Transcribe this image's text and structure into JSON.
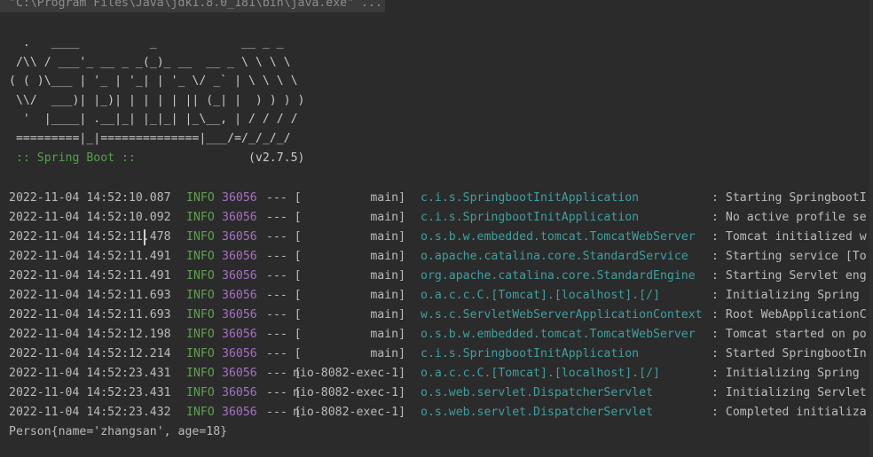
{
  "command": "\"C:\\Program Files\\Java\\jdk1.8.0_181\\bin\\java.exe\" ...",
  "banner": {
    "lines": [
      "  .   ____          _            __ _ _",
      " /\\\\ / ___'_ __ _ _(_)_ __  __ _ \\ \\ \\ \\",
      "( ( )\\___ | '_ | '_| | '_ \\/ _` | \\ \\ \\ \\",
      " \\\\/  ___)| |_)| | | | | || (_| |  ) ) ) )",
      "  '  |____| .__|_| |_|_| |_\\__, | / / / /",
      " =========|_|==============|___/=/_/_/_/"
    ],
    "spring_label": " :: Spring Boot :: ",
    "version": "               (v2.7.5)"
  },
  "logs": [
    {
      "ts": "2022-11-04 14:52:10.087",
      "level": "INFO",
      "pid": "36056",
      "sep": "--- [",
      "thread": "           main]",
      "logger": "c.i.s.SpringbootInitApplication",
      "msg": ": Starting SpringbootI"
    },
    {
      "ts": "2022-11-04 14:52:10.092",
      "level": "INFO",
      "pid": "36056",
      "sep": "--- [",
      "thread": "           main]",
      "logger": "c.i.s.SpringbootInitApplication",
      "msg": ": No active profile se"
    },
    {
      "ts": "2022-11-04 14:52:11.478",
      "level": "INFO",
      "pid": "36056",
      "sep": "--- [",
      "thread": "           main]",
      "logger": "o.s.b.w.embedded.tomcat.TomcatWebServer",
      "msg": ": Tomcat initialized w"
    },
    {
      "ts": "2022-11-04 14:52:11.491",
      "level": "INFO",
      "pid": "36056",
      "sep": "--- [",
      "thread": "           main]",
      "logger": "o.apache.catalina.core.StandardService",
      "msg": ": Starting service [To"
    },
    {
      "ts": "2022-11-04 14:52:11.491",
      "level": "INFO",
      "pid": "36056",
      "sep": "--- [",
      "thread": "           main]",
      "logger": "org.apache.catalina.core.StandardEngine",
      "msg": ": Starting Servlet eng"
    },
    {
      "ts": "2022-11-04 14:52:11.693",
      "level": "INFO",
      "pid": "36056",
      "sep": "--- [",
      "thread": "           main]",
      "logger": "o.a.c.c.C.[Tomcat].[localhost].[/]",
      "msg": ": Initializing Spring "
    },
    {
      "ts": "2022-11-04 14:52:11.693",
      "level": "INFO",
      "pid": "36056",
      "sep": "--- [",
      "thread": "           main]",
      "logger": "w.s.c.ServletWebServerApplicationContext",
      "msg": ": Root WebApplicationC"
    },
    {
      "ts": "2022-11-04 14:52:12.198",
      "level": "INFO",
      "pid": "36056",
      "sep": "--- [",
      "thread": "           main]",
      "logger": "o.s.b.w.embedded.tomcat.TomcatWebServer",
      "msg": ": Tomcat started on po"
    },
    {
      "ts": "2022-11-04 14:52:12.214",
      "level": "INFO",
      "pid": "36056",
      "sep": "--- [",
      "thread": "           main]",
      "logger": "c.i.s.SpringbootInitApplication",
      "msg": ": Started SpringbootIn"
    },
    {
      "ts": "2022-11-04 14:52:23.431",
      "level": "INFO",
      "pid": "36056",
      "sep": "--- [",
      "thread": "nio-8082-exec-1]",
      "logger": "o.a.c.c.C.[Tomcat].[localhost].[/]",
      "msg": ": Initializing Spring "
    },
    {
      "ts": "2022-11-04 14:52:23.431",
      "level": "INFO",
      "pid": "36056",
      "sep": "--- [",
      "thread": "nio-8082-exec-1]",
      "logger": "o.s.web.servlet.DispatcherServlet",
      "msg": ": Initializing Servlet"
    },
    {
      "ts": "2022-11-04 14:52:23.432",
      "level": "INFO",
      "pid": "36056",
      "sep": "--- [",
      "thread": "nio-8082-exec-1]",
      "logger": "o.s.web.servlet.DispatcherServlet",
      "msg": ": Completed initializa"
    }
  ],
  "output": "Person{name='zhangsan', age=18}",
  "colors": {
    "background": "#2b2b2b",
    "info_level": "#5fa04e",
    "pid": "#a86fc4",
    "logger": "#3f9f9f",
    "spring_label": "#54a14b"
  }
}
